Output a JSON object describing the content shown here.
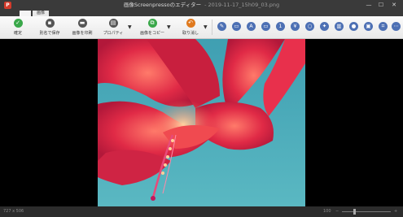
{
  "window": {
    "title": "画像Screenpressoのエディター",
    "subtitle": "- 2019-11-17_15h09_03.png",
    "app_logo_letter": "P",
    "min_glyph": "—",
    "max_glyph": "☐",
    "close_glyph": "✕"
  },
  "tabs": [
    {
      "label": ""
    },
    {
      "label": "画像"
    }
  ],
  "ribbon": {
    "buttons": [
      {
        "label": "確定",
        "icon": "check-icon",
        "glyph": "✓",
        "color": "#3aa84a"
      },
      {
        "label": "別名で保存",
        "icon": "save-icon",
        "glyph": "▪",
        "color": "#555555"
      },
      {
        "label": "画像を印刷",
        "icon": "print-icon",
        "glyph": "▬",
        "color": "#555555"
      },
      {
        "label": "プロパティ",
        "icon": "properties-icon",
        "glyph": "▤",
        "color": "#555555"
      },
      {
        "label": "画像をコピー",
        "icon": "copy-icon",
        "glyph": "⧉",
        "color": "#3aa84a"
      },
      {
        "label": "取り消し",
        "icon": "undo-icon",
        "glyph": "↶",
        "color": "#e07a1f"
      }
    ],
    "dropdown_glyph": "▼",
    "tools": [
      {
        "icon": "pen-icon",
        "glyph": "✎"
      },
      {
        "icon": "rectangle-icon",
        "glyph": "▭"
      },
      {
        "icon": "text-icon",
        "glyph": "A"
      },
      {
        "icon": "callout-icon",
        "glyph": "▭"
      },
      {
        "icon": "number-icon",
        "glyph": "1"
      },
      {
        "icon": "stamp-icon",
        "glyph": "¥"
      },
      {
        "icon": "ellipse-icon",
        "glyph": "○"
      },
      {
        "icon": "highlight-icon",
        "glyph": "✦"
      },
      {
        "icon": "blur-icon",
        "glyph": "▥"
      },
      {
        "icon": "drop-icon",
        "glyph": "●"
      },
      {
        "icon": "image-icon",
        "glyph": "▣"
      },
      {
        "icon": "crop-icon",
        "glyph": "⌗"
      },
      {
        "icon": "more-icon",
        "glyph": "⋯"
      }
    ]
  },
  "status": {
    "dimensions": "727 x 506",
    "zoom": "100",
    "zoom_minus": "−",
    "zoom_plus": "+",
    "zoom_level": 0.25
  },
  "colors": {
    "tool_blue": "#4d70b4",
    "titlebar": "#3a3a3a",
    "flower_red": "#e0304a",
    "sky": "#48a9b8"
  }
}
